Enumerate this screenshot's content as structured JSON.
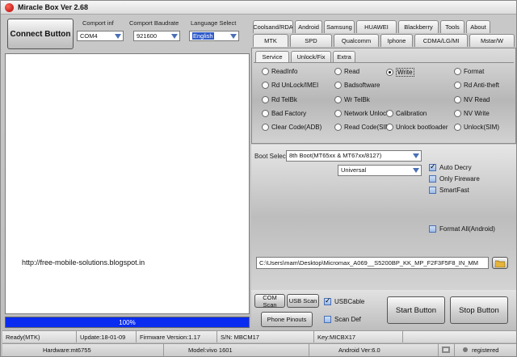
{
  "window": {
    "title": "Miracle Box Ver 2.68"
  },
  "top": {
    "connect_label": "Connect Button",
    "comport_label": "Comport inf",
    "comport_value": "COM4",
    "baud_label": "Comport Baudrate",
    "baud_value": "921600",
    "lang_label": "Language Select",
    "lang_value": "English"
  },
  "log": {
    "url": "http://free-mobile-solutions.blogspot.in"
  },
  "progress": {
    "text": "100%",
    "value": 1.0
  },
  "tabs_row1": [
    "Coolsand/RDA",
    "Android",
    "Samsung",
    "HUAWEI",
    "Blackberry",
    "Tools",
    "About"
  ],
  "tabs_row2": [
    "MTK",
    "SPD",
    "Qualcomm",
    "Iphone",
    "CDMA/LG/MI",
    "Mstar/W"
  ],
  "subtabs": [
    "Service",
    "Unlock/Fix",
    "Extra"
  ],
  "radios": [
    [
      "ReadInfo",
      "Read",
      "Write",
      "Format"
    ],
    [
      "Rd UnLock/IMEI",
      "Badsoftware",
      "",
      "Rd Anti-theft"
    ],
    [
      "Rd TelBk",
      "Wr TelBk",
      "",
      "NV Read"
    ],
    [
      "Bad Factory",
      "Network Unlock",
      "Calibration",
      "NV Write"
    ],
    [
      "Clear Code(ADB)",
      "Read Code(SIM)",
      "Unlock bootloader",
      "Unlock(SIM)"
    ]
  ],
  "selected_radio": "Write",
  "settings": {
    "boot_label": "Boot Selec",
    "boot_value": "8th Boot(MT65xx & MT67xx/8127)",
    "mode_value": "Universal",
    "auto_decry": "Auto Decry",
    "only_firmware": "Only Fireware",
    "smart_fast": "SmartFast",
    "format_all": "Format All(Android)"
  },
  "path": {
    "value": "C:\\Users\\mam\\Desktop\\Micromax_A069__S5200BP_KK_MP_F2F3F5F8_IN_MM"
  },
  "bottom": {
    "com_scan": "COM Scan",
    "usb_scan": "USB Scan",
    "usb_cable": "USBCable",
    "phone_pinouts": "Phone Pinouts",
    "scan_def": "Scan Def",
    "start": "Start Button",
    "stop": "Stop Button"
  },
  "status": {
    "ready": "Ready(MTK)",
    "update": "Update:18-01-09",
    "firmware": "Firmware Version:1.17",
    "sn": "S/N: MBCM17",
    "key": "Key:MICBX17",
    "hardware": "Hardware:mt6755",
    "model": "Model:vivo 1601",
    "android": "Android Ver:6.0",
    "registered": "registered"
  }
}
